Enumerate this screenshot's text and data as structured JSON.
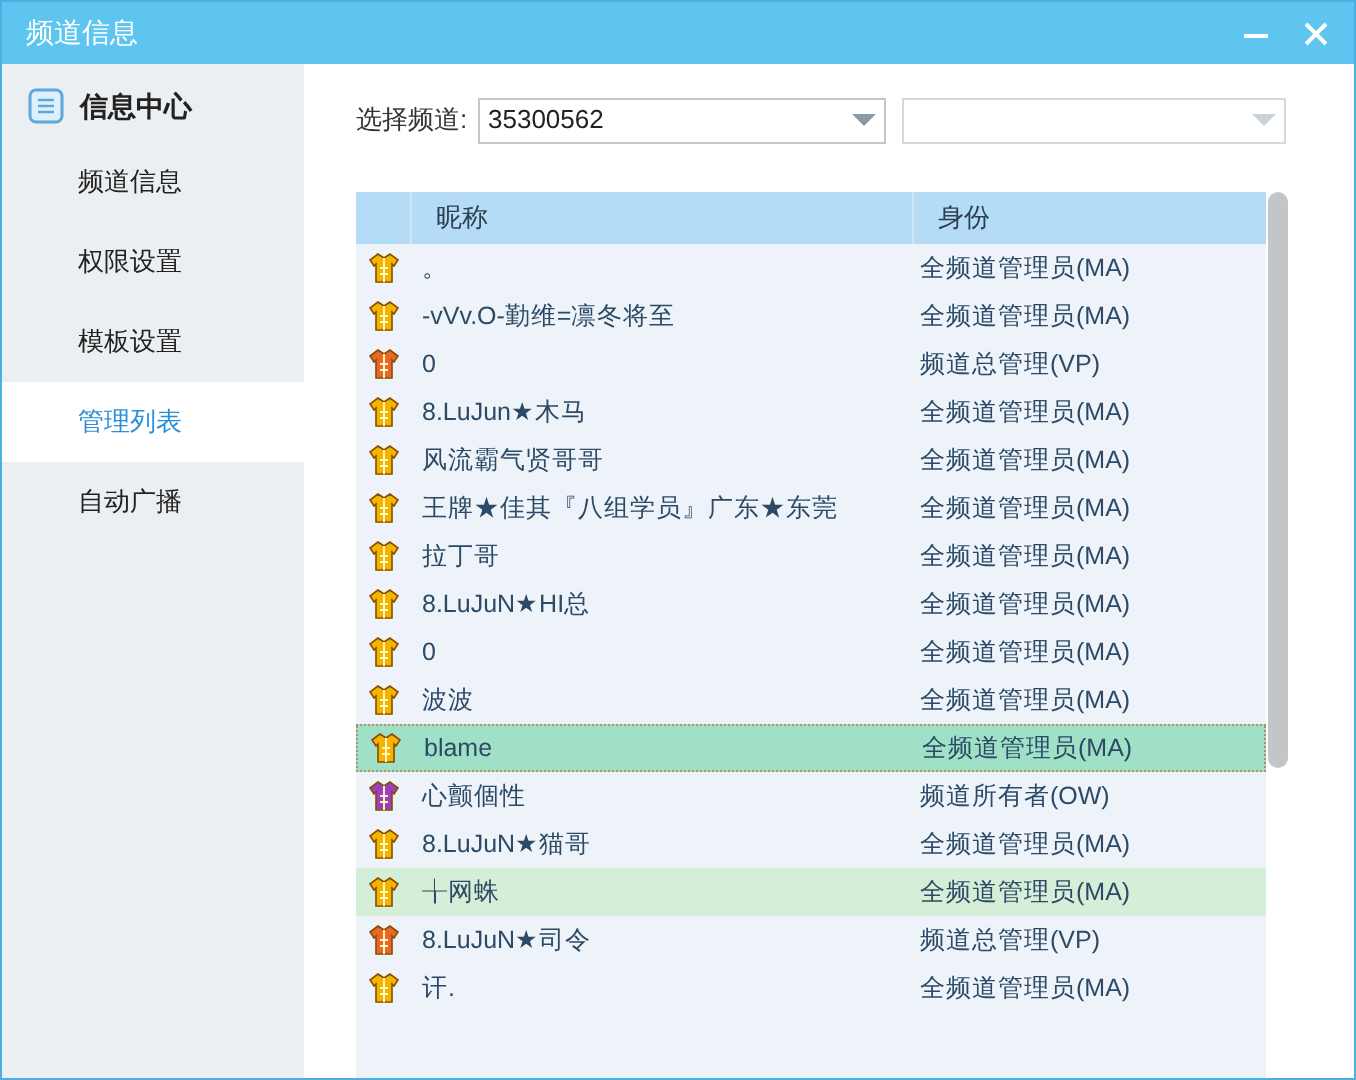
{
  "window": {
    "title": "频道信息"
  },
  "sidebar": {
    "header": "信息中心",
    "items": [
      {
        "label": "频道信息",
        "selected": false
      },
      {
        "label": "权限设置",
        "selected": false
      },
      {
        "label": "模板设置",
        "selected": false
      },
      {
        "label": "管理列表",
        "selected": true
      },
      {
        "label": "自动广播",
        "selected": false
      }
    ]
  },
  "channel_select": {
    "label": "选择频道:",
    "value": "35300562"
  },
  "table": {
    "columns": [
      "昵称",
      "身份"
    ],
    "rows": [
      {
        "name": "。",
        "role": "全频道管理员(MA)",
        "color": "#f5b400",
        "selected": false,
        "hovered": false
      },
      {
        "name": "-vVv.O-勤维=凛冬将至",
        "role": "全频道管理员(MA)",
        "color": "#f5b400",
        "selected": false,
        "hovered": false
      },
      {
        "name": "0",
        "role": "频道总管理(VP)",
        "color": "#e8682a",
        "selected": false,
        "hovered": false
      },
      {
        "name": "8.LuJun★木马",
        "role": "全频道管理员(MA)",
        "color": "#f5b400",
        "selected": false,
        "hovered": false
      },
      {
        "name": "风流霸气贤哥哥",
        "role": "全频道管理员(MA)",
        "color": "#f5b400",
        "selected": false,
        "hovered": false
      },
      {
        "name": "王牌★佳其『八组学员』广东★东莞",
        "role": "全频道管理员(MA)",
        "color": "#f5b400",
        "selected": false,
        "hovered": false
      },
      {
        "name": "拉丁哥",
        "role": "全频道管理员(MA)",
        "color": "#f5b400",
        "selected": false,
        "hovered": false
      },
      {
        "name": "8.LuJuN★HI总",
        "role": "全频道管理员(MA)",
        "color": "#f5b400",
        "selected": false,
        "hovered": false
      },
      {
        "name": "0",
        "role": "全频道管理员(MA)",
        "color": "#f5b400",
        "selected": false,
        "hovered": false
      },
      {
        "name": "波波",
        "role": "全频道管理员(MA)",
        "color": "#f5b400",
        "selected": false,
        "hovered": false
      },
      {
        "name": "blame",
        "role": "全频道管理员(MA)",
        "color": "#f5b400",
        "selected": true,
        "hovered": false
      },
      {
        "name": "心颤個性",
        "role": "频道所有者(OW)",
        "color": "#9b3fc0",
        "selected": false,
        "hovered": false
      },
      {
        "name": "8.LuJuN★猫哥",
        "role": "全频道管理员(MA)",
        "color": "#f5b400",
        "selected": false,
        "hovered": false
      },
      {
        "name": "╁网蛛",
        "role": "全频道管理员(MA)",
        "color": "#f5b400",
        "selected": false,
        "hovered": true
      },
      {
        "name": "8.LuJuN★司令",
        "role": "频道总管理(VP)",
        "color": "#e8682a",
        "selected": false,
        "hovered": false
      },
      {
        "name": "讦.",
        "role": "全频道管理员(MA)",
        "color": "#f5b400",
        "selected": false,
        "hovered": false
      }
    ]
  }
}
